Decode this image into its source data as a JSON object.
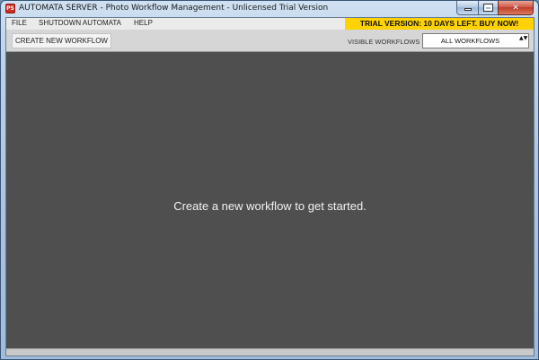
{
  "window": {
    "title": "AUTOMATA SERVER - Photo Workflow Management - Unlicensed Trial Version",
    "icon_text": "PS",
    "icons": {
      "minimize": "minimize-icon",
      "maximize": "maximize-icon",
      "close": "close-icon"
    },
    "close_glyph": "✕"
  },
  "menubar": {
    "items": [
      {
        "label": "FILE"
      },
      {
        "label": "SHUTDOWN AUTOMATA"
      },
      {
        "label": "HELP"
      }
    ],
    "trial_banner": "TRIAL VERSION: 10 DAYS LEFT. BUY NOW!"
  },
  "toolbar": {
    "create_label": "CREATE NEW WORKFLOW",
    "visible_label": "VISIBLE WORKFLOWS",
    "visible_selected": "ALL WORKFLOWS",
    "select_arrow": "▲▼"
  },
  "main": {
    "empty_message": "Create a new workflow to get started."
  },
  "colors": {
    "content_bg": "#4f4f4f",
    "banner_bg": "#ffd200",
    "menubar_bg": "#ebebeb",
    "toolbar_bg": "#d6d6d6"
  }
}
